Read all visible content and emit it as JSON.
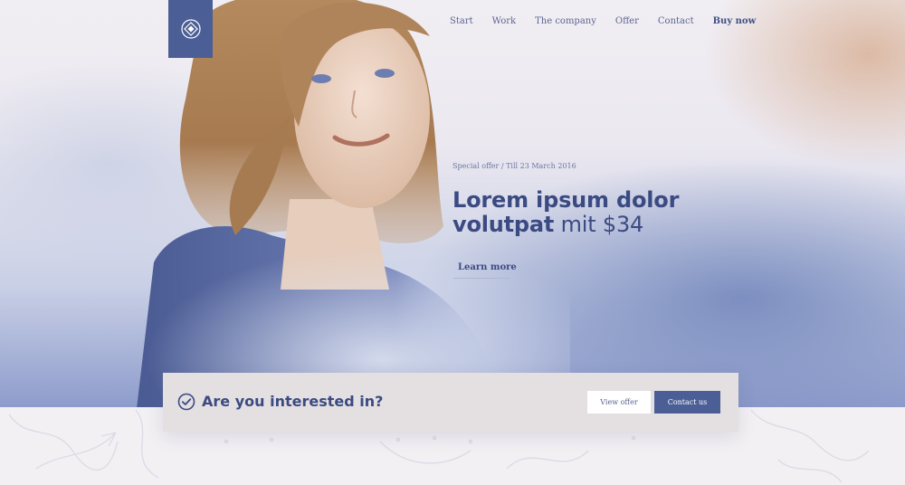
{
  "brand": {
    "logo_icon": "diamond-emblem-icon",
    "logo_bg": "#4b5e95"
  },
  "nav": {
    "items": [
      {
        "label": "Start"
      },
      {
        "label": "Work"
      },
      {
        "label": "The company"
      },
      {
        "label": "Offer"
      },
      {
        "label": "Contact"
      },
      {
        "label": "Buy now"
      }
    ]
  },
  "hero": {
    "eyebrow": "Special offer / Till 23 March 2016",
    "headline_bold_1": "Lorem ipsum dolor",
    "headline_bold_2": "volutpat",
    "headline_light": " mit $34",
    "cta_link": "Learn more"
  },
  "interest_bar": {
    "icon": "check-circle-icon",
    "title": "Are you interested in?",
    "view_offer": "View offer",
    "contact_us": "Contact us"
  },
  "colors": {
    "accent": "#4b5e95",
    "heading": "#3b4b82",
    "bar_bg": "#e4dfe1"
  }
}
